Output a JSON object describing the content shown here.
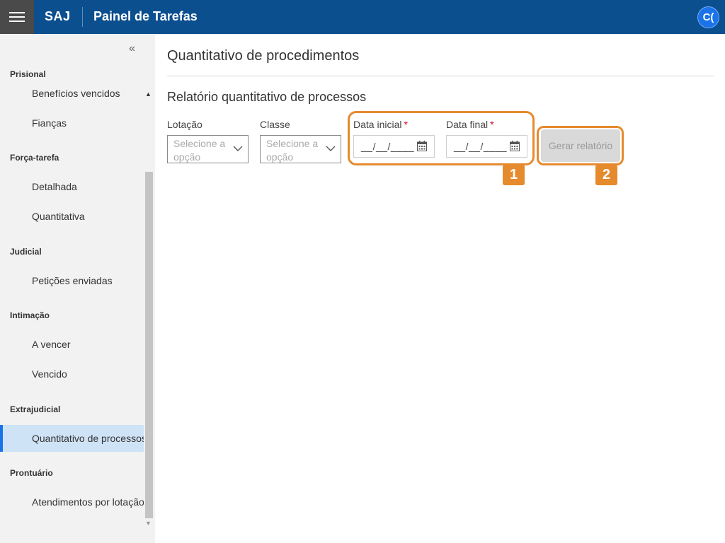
{
  "colors": {
    "brand": "#0b4f8f",
    "accent": "#1a73e8",
    "highlight": "#e68a2e",
    "required": "#d9001b"
  },
  "header": {
    "menu_icon": "hamburger-icon",
    "brand": "SAJ",
    "title": "Painel de Tarefas",
    "avatar_initials": "C("
  },
  "sidebar": {
    "collapse_icon": "double-chevron-left-icon",
    "groups": [
      {
        "label": "Prisional",
        "items": [
          "Benefícios vencidos",
          "Fianças"
        ]
      },
      {
        "label": "Força-tarefa",
        "items": [
          "Detalhada",
          "Quantitativa"
        ]
      },
      {
        "label": "Judicial",
        "items": [
          "Petições enviadas"
        ]
      },
      {
        "label": "Intimação",
        "items": [
          "A vencer",
          "Vencido"
        ]
      },
      {
        "label": "Extrajudicial",
        "items": [
          "Quantitativo de processos"
        ]
      },
      {
        "label": "Prontuário",
        "items": [
          "Atendimentos por lotação"
        ]
      }
    ],
    "active_item": "Quantitativo de processos"
  },
  "main": {
    "page_title": "Quantitativo de procedimentos",
    "section_title": "Relatório quantitativo de processos",
    "form": {
      "lotacao": {
        "label": "Lotação",
        "placeholder": "Selecione a opção",
        "icon": "chevron-down-icon"
      },
      "classe": {
        "label": "Classe",
        "placeholder": "Selecione a opção",
        "icon": "chevron-down-icon"
      },
      "data_inicial": {
        "label": "Data inicial",
        "required_mark": "*",
        "value": "__/__/____",
        "icon": "calendar-icon"
      },
      "data_final": {
        "label": "Data final",
        "required_mark": "*",
        "value": "__/__/____",
        "icon": "calendar-icon"
      },
      "generate_button": "Gerar relatório"
    },
    "callouts": [
      "1",
      "2"
    ]
  }
}
